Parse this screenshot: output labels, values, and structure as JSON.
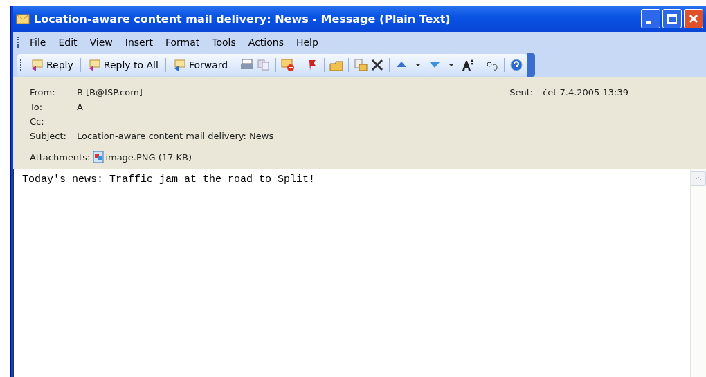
{
  "window": {
    "title": "Location-aware content mail delivery: News - Message (Plain Text)"
  },
  "menu": [
    "File",
    "Edit",
    "View",
    "Insert",
    "Format",
    "Tools",
    "Actions",
    "Help"
  ],
  "toolbar": [
    {
      "kind": "labeled",
      "label": "Reply"
    },
    {
      "kind": "labeled",
      "label": "Reply to All"
    },
    {
      "kind": "labeled",
      "label": "Forward"
    }
  ],
  "header": {
    "from": {
      "label": "From:",
      "value": "B [B@ISP.com]"
    },
    "sent": {
      "label": "Sent:",
      "value": "čet 7.4.2005 13:39"
    },
    "to": {
      "label": "To:",
      "value": "A"
    },
    "cc": {
      "label": "Cc:"
    },
    "subject": {
      "label": "Subject:",
      "value": "Location-aware content mail delivery: News"
    },
    "attachments": {
      "label": "Attachments:",
      "file": "image.PNG (17 KB)"
    }
  },
  "body": "Today's news: Traffic jam at the road to Split!"
}
